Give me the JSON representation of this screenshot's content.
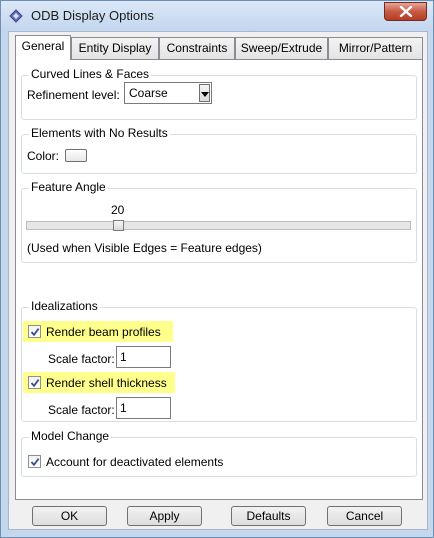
{
  "window": {
    "title": "ODB Display Options",
    "app_icon": "abaqus-icon",
    "close_icon": "close-icon"
  },
  "tabs": [
    {
      "label": "General",
      "active": true
    },
    {
      "label": "Entity Display",
      "active": false
    },
    {
      "label": "Constraints",
      "active": false
    },
    {
      "label": "Sweep/Extrude",
      "active": false
    },
    {
      "label": "Mirror/Pattern",
      "active": false
    }
  ],
  "curved": {
    "title": "Curved Lines & Faces",
    "refinement_label": "Refinement level:",
    "refinement_value": "Coarse"
  },
  "no_results": {
    "title": "Elements with No Results",
    "color_label": "Color:"
  },
  "feature_angle": {
    "title": "Feature Angle",
    "value": "20",
    "note": "(Used when Visible Edges = Feature edges)"
  },
  "idealizations": {
    "title": "Idealizations",
    "beam_label": "Render beam profiles",
    "beam_checked": true,
    "beam_scale_label": "Scale factor:",
    "beam_scale_value": "1",
    "shell_label": "Render shell thickness",
    "shell_checked": true,
    "shell_scale_label": "Scale factor:",
    "shell_scale_value": "1",
    "highlight_color": "#ffff8c"
  },
  "model_change": {
    "title": "Model Change",
    "deactivated_label": "Account for deactivated elements",
    "deactivated_checked": true
  },
  "buttons": {
    "ok": "OK",
    "apply": "Apply",
    "defaults": "Defaults",
    "cancel": "Cancel"
  }
}
